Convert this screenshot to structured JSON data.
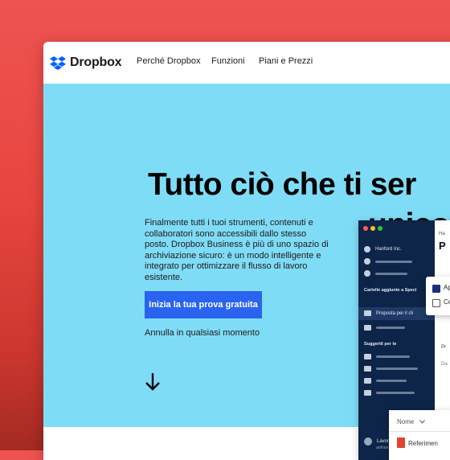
{
  "nav": {
    "brand": "Dropbox",
    "links": [
      "Perché Dropbox",
      "Funzioni",
      "Piani e Prezzi"
    ]
  },
  "hero": {
    "headline_line1": "Tutto ciò che ti ser",
    "headline_line2": "unico",
    "paragraph": "Finalmente tutti i tuoi strumenti, contenuti e collaboratori sono accessibili dallo stesso posto. Dropbox Business è più di uno spazio di archiviazione sicuro: è un modo intelligente e integrato per ottimizzare il flusso di lavoro esistente.",
    "cta_label": "Inizia la tua prova gratuita",
    "cancel_text": "Annulla in qualsiasi momento"
  },
  "app": {
    "workspace": "Hanford Inc.",
    "shared_heading": "Cartelle aggiunte a Speci",
    "selected_folder": "Proposta per il cli",
    "suggested_heading": "Suggeriti per te",
    "main_header_small": "Ha",
    "main_header_large": "P",
    "popup_items": [
      "Ap",
      "Co"
    ],
    "main_label_1": "Pr",
    "main_label_2": "Da",
    "bottom_user": "Lavor",
    "bottom_user_sub": "anthon",
    "dropdown_label": "Nome",
    "dropdown_item": "Referimen"
  },
  "colors": {
    "hero_bg": "#7fdcf6",
    "cta_bg": "#2a63f0",
    "sidebar_bg": "#0d2548",
    "brand_blue": "#0061fe"
  }
}
